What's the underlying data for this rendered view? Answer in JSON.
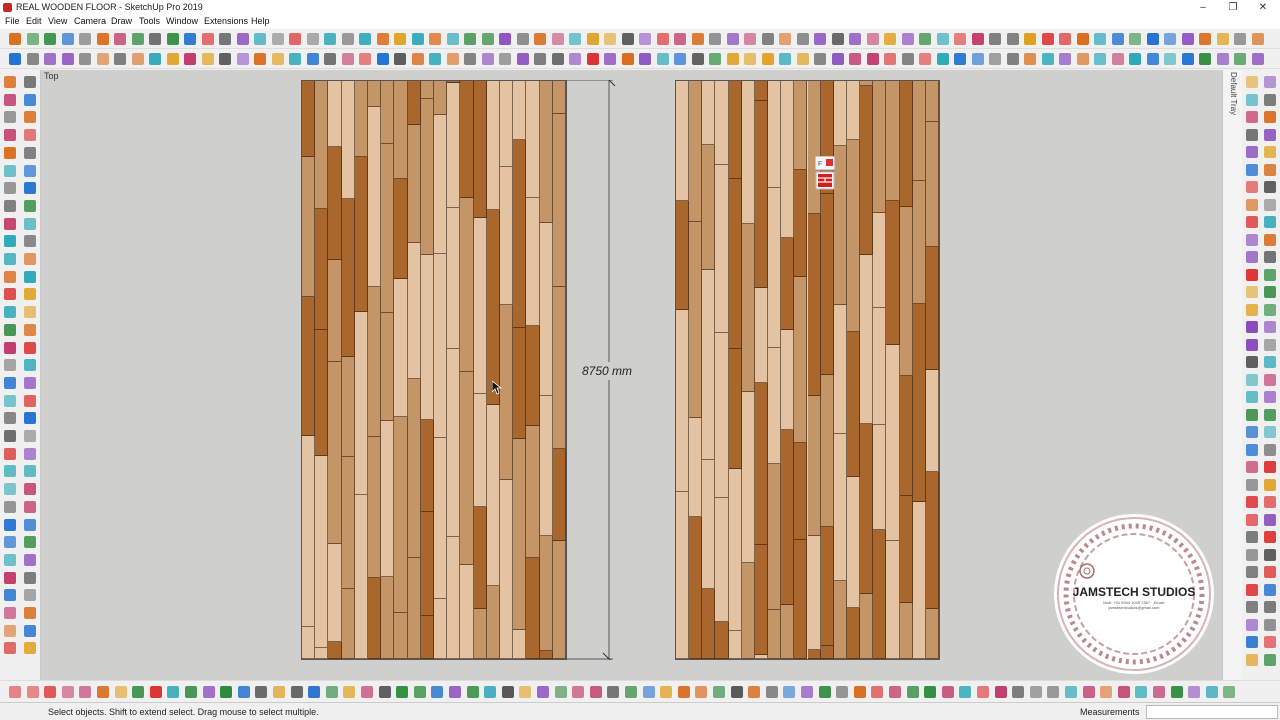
{
  "window": {
    "title": "REAL WOODEN FLOOR - SketchUp Pro 2019",
    "minimize": "–",
    "maximize": "❐",
    "close": "✕"
  },
  "menu": [
    "File",
    "Edit",
    "View",
    "Camera",
    "Draw",
    "Tools",
    "Window",
    "Extensions",
    "Help"
  ],
  "viewport": {
    "view_label": "Top",
    "dimension_label": "8750 mm"
  },
  "tray": {
    "label": "Default Tray"
  },
  "logo": {
    "name": "JAMSTECH STUDIOS",
    "fine_print": "Mob: +91 9944 1049 7367 · Email: jamstechstudios@gmail.com"
  },
  "status": {
    "hint": "Select objects. Shift to extend select. Drag mouse to select multiple.",
    "measurements_label": "Measurements",
    "measurements_value": ""
  },
  "icons": {
    "titlebar": "sketchup-app-icon",
    "component_marker": "component-axes-icon",
    "cursor": "arrow-cursor-icon"
  },
  "colors": {
    "plank_light": "#e3c3a2",
    "plank_mid": "#c49567",
    "plank_dark": "#a9672e",
    "viewport_bg": "#cfd0ce",
    "accent_red": "#cf1f1f"
  }
}
